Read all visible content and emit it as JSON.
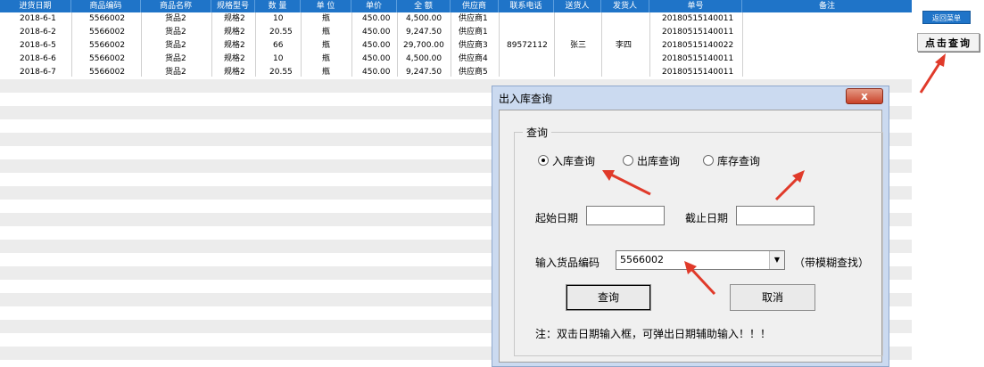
{
  "sheet": {
    "headers": [
      "进货日期",
      "商品编码",
      "商品名称",
      "规格型号",
      "数  量",
      "单  位",
      "单价",
      "全  额",
      "供应商",
      "联系电话",
      "送货人",
      "发货人",
      "单号",
      "备注"
    ],
    "rows": [
      [
        "2018-6-1",
        "5566002",
        "货品2",
        "规格2",
        "10",
        "瓶",
        "450.00",
        "4,500.00",
        "供应商1",
        "",
        "",
        "",
        "20180515140011",
        ""
      ],
      [
        "2018-6-2",
        "5566002",
        "货品2",
        "规格2",
        "20.55",
        "瓶",
        "450.00",
        "9,247.50",
        "供应商1",
        "",
        "",
        "",
        "20180515140011",
        ""
      ],
      [
        "2018-6-5",
        "5566002",
        "货品2",
        "规格2",
        "66",
        "瓶",
        "450.00",
        "29,700.00",
        "供应商3",
        "89572112",
        "张三",
        "李四",
        "20180515140022",
        ""
      ],
      [
        "2018-6-6",
        "5566002",
        "货品2",
        "规格2",
        "10",
        "瓶",
        "450.00",
        "4,500.00",
        "供应商4",
        "",
        "",
        "",
        "20180515140011",
        ""
      ],
      [
        "2018-6-7",
        "5566002",
        "货品2",
        "规格2",
        "20.55",
        "瓶",
        "450.00",
        "9,247.50",
        "供应商5",
        "",
        "",
        "",
        "20180515140011",
        ""
      ]
    ]
  },
  "buttons": {
    "back_menu": "返回菜单",
    "click_query": "点击查询"
  },
  "dialog": {
    "title": "出入库查询",
    "close": "x",
    "group": "查询",
    "radios": [
      "入库查询",
      "出库查询",
      "库存查询"
    ],
    "selected_radio": "入库查询",
    "start_date_label": "起始日期",
    "end_date_label": "截止日期",
    "start_date_value": "",
    "end_date_value": "",
    "code_label": "输入货品编码",
    "code_value": "5566002",
    "fuzzy_hint": "（带模糊查找）",
    "query_button": "查询",
    "cancel_button": "取消",
    "note": "注：双击日期输入框，可弹出日期辅助输入！！！"
  },
  "colors": {
    "header_blue": "#1f74c8",
    "stripe_gray": "#ececec",
    "arrow_red": "#e03a2a",
    "dialog_frame": "#cbdaf0"
  }
}
